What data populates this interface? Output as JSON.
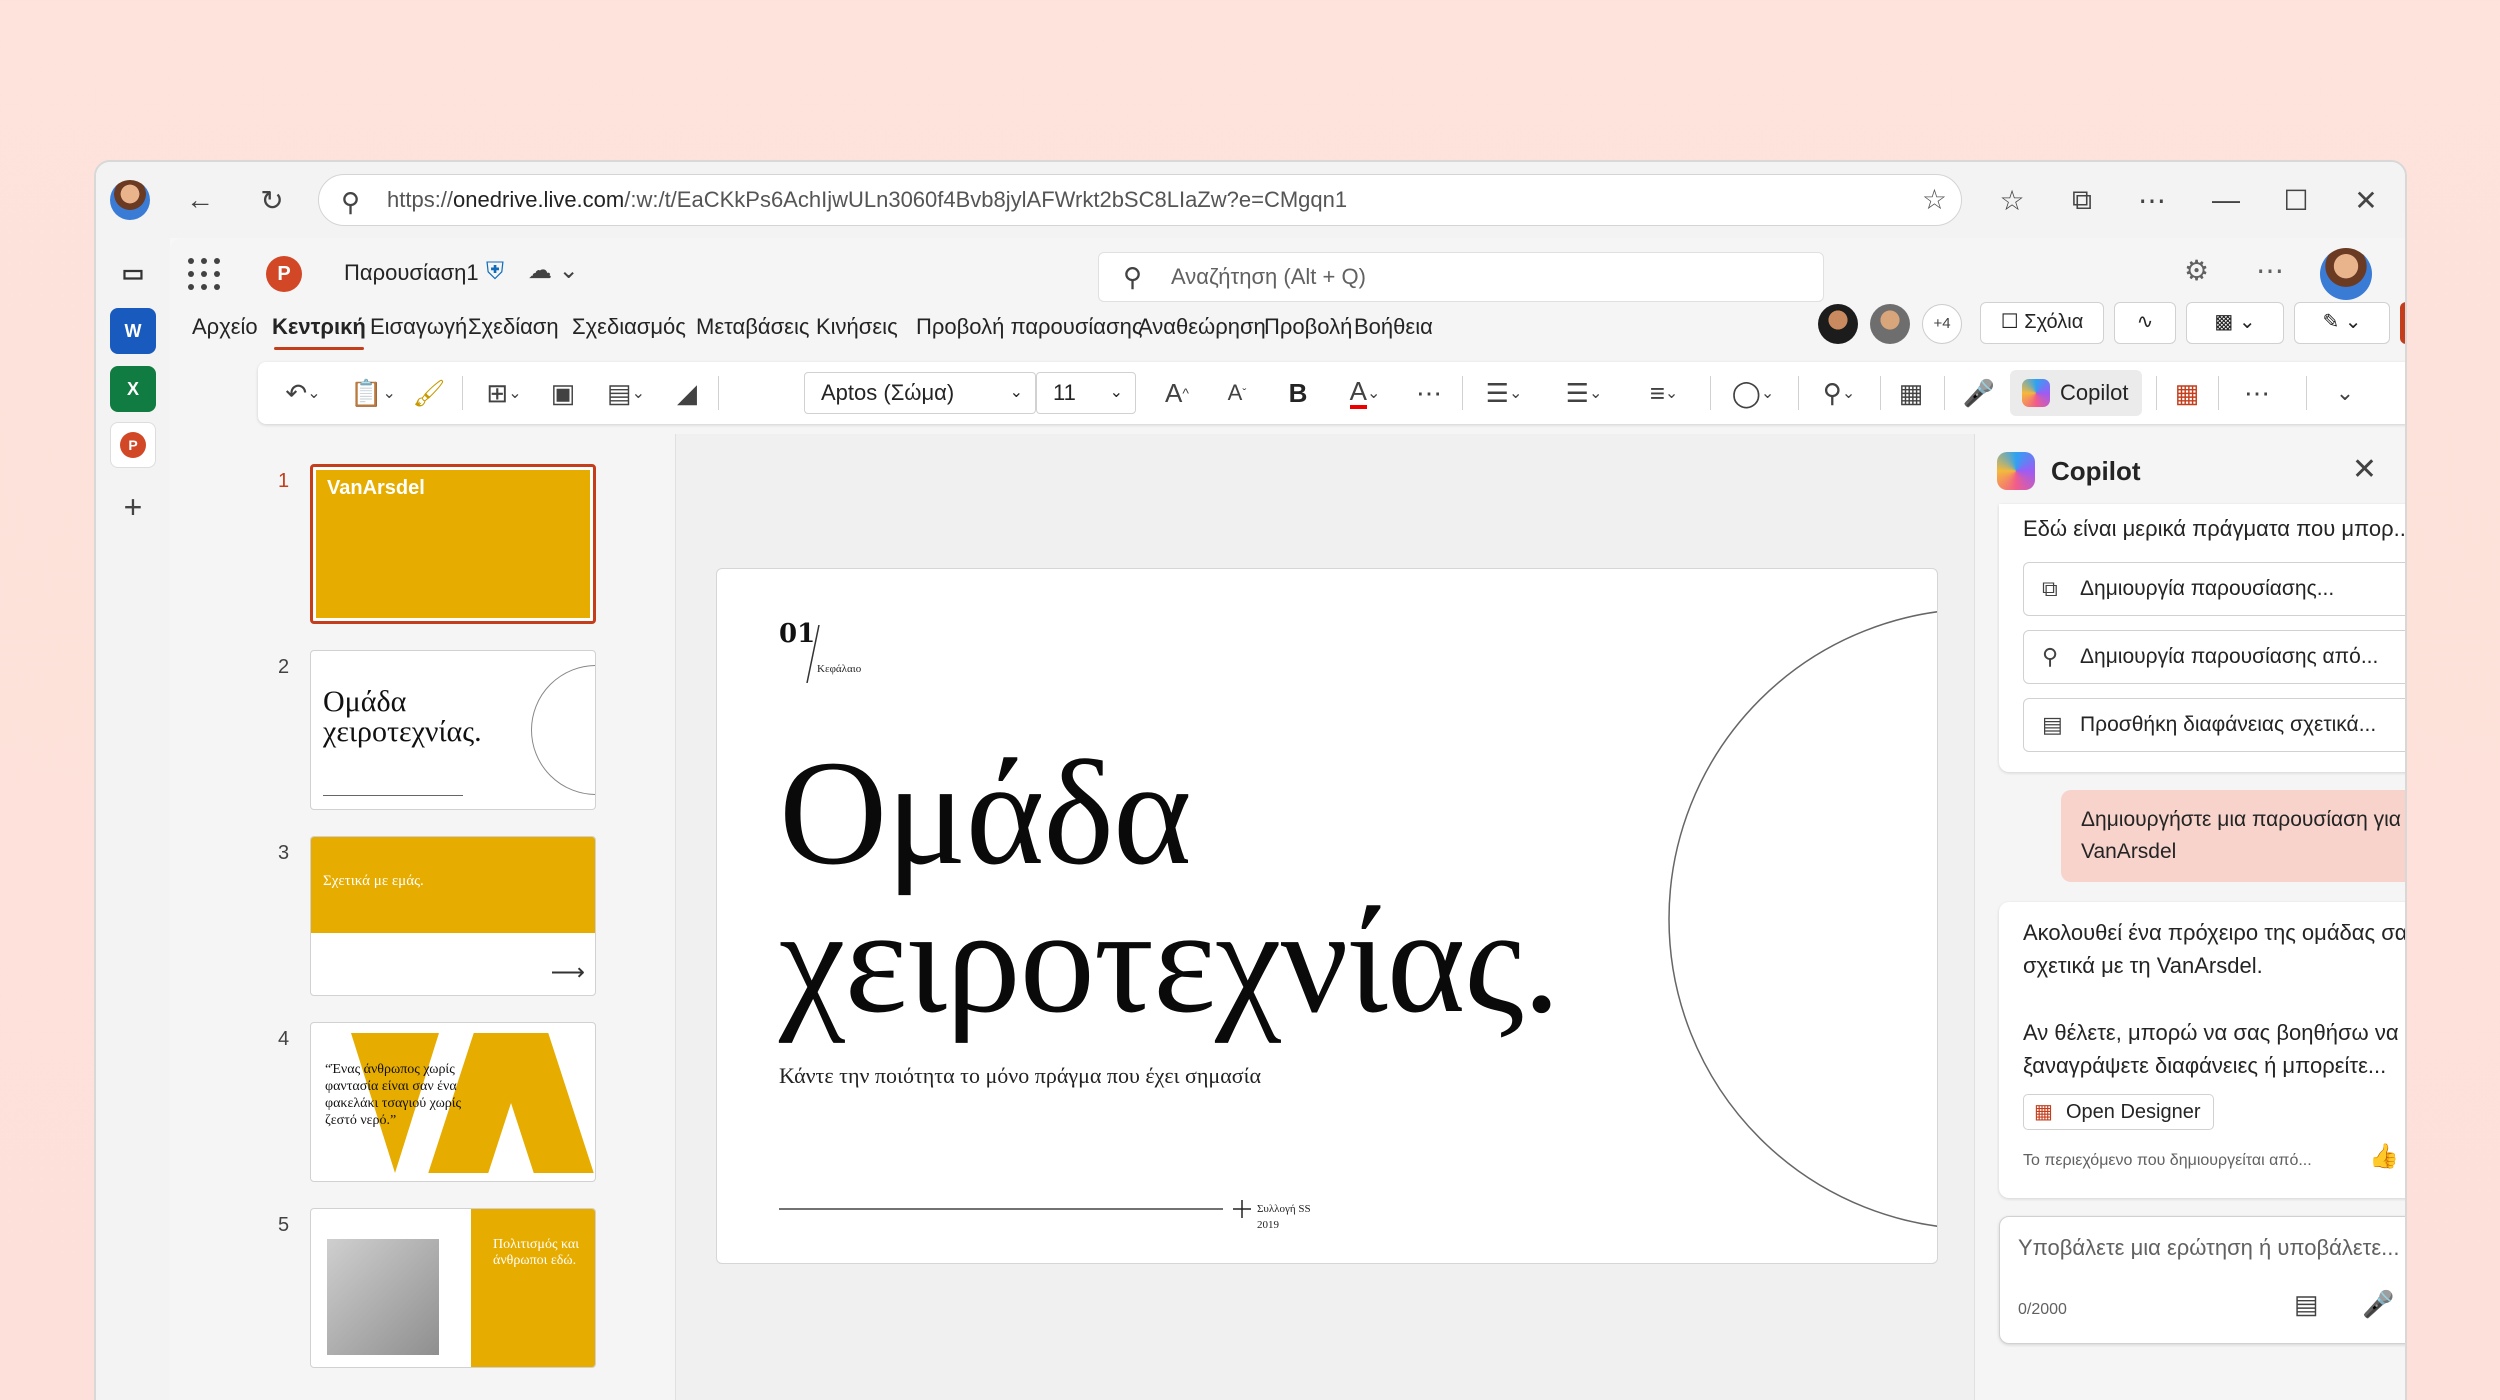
{
  "browser": {
    "url_prefix": "https://",
    "url_host": "onedrive.live.com",
    "url_path": "/:w:/t/EaCKkPs6AchIjwULn3060f4Bvb8jylAFWrkt2bSC8LIaZw?e=CMgqn1"
  },
  "app": {
    "doc_name": "Παρουσίαση1",
    "search_placeholder": "Αναζήτηση (Alt + Q)",
    "menu": [
      "Αρχείο",
      "Κεντρική",
      "Εισαγωγή",
      "Σχεδίαση",
      "Σχεδιασμός",
      "Μεταβάσεις",
      "Κινήσεις",
      "Προβολή παρουσίασης",
      "Αναθεώρηση",
      "Προβολή",
      "Βοήθεια"
    ],
    "active_menu_index": 1,
    "collaborators_more": "+4",
    "comments_label": "Σχόλια",
    "accent_color": "#c43e1c"
  },
  "ribbon": {
    "font_name": "Aptos (Σώμα)",
    "font_size": "11",
    "bold_glyph": "B",
    "copilot_label": "Copilot"
  },
  "thumbnails": [
    {
      "num": "1",
      "brand": "VanArsdel"
    },
    {
      "num": "2",
      "title": "Ομάδα χειροτεχνίας."
    },
    {
      "num": "3",
      "title": "Σχετικά με εμάς."
    },
    {
      "num": "4",
      "quote": "“Ένας άνθρωπος χωρίς φαντασία είναι σαν ένα φακελάκι τσαγιού χωρίς ζεστό νερό.”"
    },
    {
      "num": "5",
      "title": "Πολιτισμός και άνθρωποι εδώ."
    }
  ],
  "slide": {
    "num": "01",
    "chapter": "Κεφάλαιο",
    "title_line1": "Ομάδα",
    "title_line2": "χειροτεχνίας.",
    "subtitle": "Κάντε την ποιότητα το μόνο πράγμα που έχει σημασία",
    "footer_line1": "Συλλογή SS",
    "footer_line2": "2019"
  },
  "copilot": {
    "title": "Copilot",
    "intro": "Εδώ είναι μερικά πράγματα που μπορ...",
    "suggestions": [
      "Δημιουργία παρουσίασης...",
      "Δημιουργία παρουσίασης από...",
      "Προσθήκη διαφάνειας σχετικά..."
    ],
    "user_message": "Δημιουργήστε μια παρουσίαση για το VanArsdel",
    "reply_p1": "Ακολουθεί ένα πρόχειρο της ομάδας σας σχετικά με τη VanArsdel.",
    "reply_p2": "Αν θέλετε, μπορώ να σας βοηθήσω να ξαναγράψετε διαφάνειες ή μπορείτε...",
    "designer_label": "Open Designer",
    "disclaimer": "Το περιεχόμενο που δημιουργείται από...",
    "input_placeholder": "Υποβάλετε μια ερώτηση ή υποβάλετε...",
    "char_count": "0/2000"
  }
}
